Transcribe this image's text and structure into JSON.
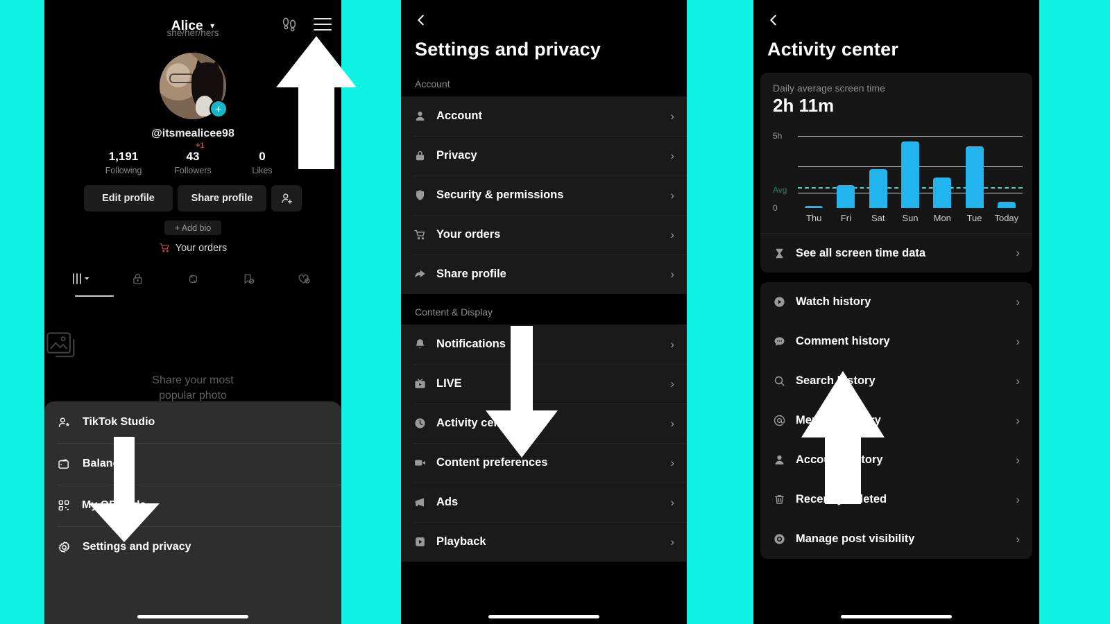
{
  "theme": {
    "background": "#0EF2E4",
    "panel_bg": "#000000",
    "accent_bar": "#21B4EF",
    "badge_red": "#E8444C",
    "plus_teal": "#18B4C7"
  },
  "panel1": {
    "name": "Alice",
    "caret_icon": "chevron-down-icon",
    "pronouns": "she/her/hers",
    "footsteps_icon": "footsteps-icon",
    "menu_icon": "hamburger-menu-icon",
    "avatar_plus": "+",
    "handle": "@itsmealicee98",
    "stats": [
      {
        "num": "1,191",
        "label": "Following",
        "badge": ""
      },
      {
        "num": "43",
        "label": "Followers",
        "badge": "+1"
      },
      {
        "num": "0",
        "label": "Likes",
        "badge": ""
      }
    ],
    "buttons": {
      "edit": "Edit profile",
      "share": "Share profile",
      "add_friend_icon": "add-person-icon"
    },
    "add_bio": "+ Add bio",
    "orders": "Your orders",
    "orders_icon": "shopping-cart-icon",
    "tabs": [
      {
        "icon": "posts-grid-icon",
        "active": true
      },
      {
        "icon": "lock-icon",
        "active": false
      },
      {
        "icon": "repost-icon",
        "active": false
      },
      {
        "icon": "saved-hidden-icon",
        "active": false
      },
      {
        "icon": "liked-hidden-icon",
        "active": false
      }
    ],
    "empty_state": {
      "icon": "photo-stack-icon",
      "line1": "Share your most",
      "line2": "popular photo"
    },
    "sheet": [
      {
        "icon": "studio-person-star-icon",
        "label": "TikTok Studio"
      },
      {
        "icon": "wallet-icon",
        "label": "Balance"
      },
      {
        "icon": "qr-code-icon",
        "label": "My QR code"
      },
      {
        "icon": "gear-icon",
        "label": "Settings and privacy"
      }
    ]
  },
  "panel2": {
    "back_icon": "back-chevron-icon",
    "title": "Settings and privacy",
    "sections": [
      {
        "label": "Account",
        "items": [
          {
            "icon": "person-icon",
            "label": "Account"
          },
          {
            "icon": "lock-icon",
            "label": "Privacy"
          },
          {
            "icon": "shield-icon",
            "label": "Security & permissions"
          },
          {
            "icon": "shopping-cart-icon",
            "label": "Your orders"
          },
          {
            "icon": "share-arrow-icon",
            "label": "Share profile"
          }
        ]
      },
      {
        "label": "Content & Display",
        "items": [
          {
            "icon": "bell-icon",
            "label": "Notifications"
          },
          {
            "icon": "live-tv-icon",
            "label": "LIVE"
          },
          {
            "icon": "clock-icon",
            "label": "Activity center"
          },
          {
            "icon": "video-camera-icon",
            "label": "Content preferences"
          },
          {
            "icon": "megaphone-icon",
            "label": "Ads"
          },
          {
            "icon": "play-box-icon",
            "label": "Playback"
          }
        ]
      }
    ]
  },
  "panel3": {
    "back_icon": "back-chevron-icon",
    "title": "Activity center",
    "screen_time": {
      "subtitle": "Daily average screen time",
      "value": "2h 11m"
    },
    "see_all": {
      "icon": "hourglass-icon",
      "label": "See all screen time data"
    },
    "history_items": [
      {
        "icon": "play-circle-icon",
        "label": "Watch history"
      },
      {
        "icon": "comment-bubble-icon",
        "label": "Comment history"
      },
      {
        "icon": "search-icon",
        "label": "Search history"
      },
      {
        "icon": "at-mention-icon",
        "label": "Mention history"
      },
      {
        "icon": "person-icon",
        "label": "Account history"
      },
      {
        "icon": "trash-icon",
        "label": "Recently deleted"
      },
      {
        "icon": "eye-icon",
        "label": "Manage post visibility"
      }
    ]
  },
  "chart_data": {
    "type": "bar",
    "title": "Daily average screen time",
    "subtitle": "2h 11m",
    "categories": [
      "Thu",
      "Fri",
      "Sat",
      "Sun",
      "Mon",
      "Tue",
      "Today"
    ],
    "values": [
      0.1,
      1.4,
      2.4,
      4.1,
      1.9,
      3.8,
      0.35
    ],
    "unit": "hours",
    "xlabel": "",
    "ylabel": "",
    "ylim": [
      0,
      5
    ],
    "yticks": [
      {
        "value": 5,
        "label": "5h"
      },
      {
        "value": 0,
        "label": "0"
      }
    ],
    "gridlines": [
      5,
      3.4,
      2.05
    ],
    "average_line": {
      "value": 2.18,
      "label": "Avg",
      "style": "dashed",
      "color": "#4fd0c4"
    },
    "bar_color": "#21B4EF",
    "grid": true,
    "legend": "none"
  },
  "annotations": {
    "arrow1": {
      "direction": "up",
      "points_to": "hamburger-menu-icon"
    },
    "arrow2": {
      "direction": "down",
      "points_to": "settings-and-privacy-sheet-item"
    },
    "arrow3": {
      "direction": "down",
      "points_to": "activity-center-row"
    },
    "arrow4": {
      "direction": "up",
      "points_to": "watch-history-row"
    }
  }
}
